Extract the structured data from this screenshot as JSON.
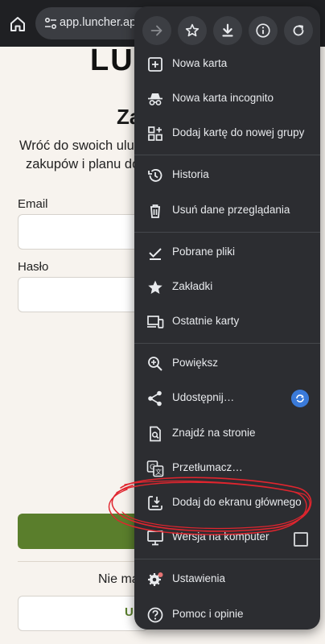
{
  "browser": {
    "url": "app.luncher.app/au"
  },
  "page": {
    "logo": "LUI",
    "heading": "Za",
    "subtitle_line1": "Wróć do swoich ulub",
    "subtitle_line2": "zakupów i planu dop",
    "email_label": "Email",
    "password_label": "Hasło",
    "no_account_text": "Nie ma",
    "alt_button_text": "U"
  },
  "menu": {
    "toolbar": [
      {
        "name": "forward-icon"
      },
      {
        "name": "bookmark-star-icon"
      },
      {
        "name": "download-icon"
      },
      {
        "name": "info-icon"
      },
      {
        "name": "reload-icon"
      }
    ],
    "items": [
      {
        "label": "Nowa karta",
        "icon": "new-tab-icon"
      },
      {
        "label": "Nowa karta incognito",
        "icon": "incognito-icon"
      },
      {
        "label": "Dodaj kartę do nowej grupy",
        "icon": "tab-group-icon"
      },
      {
        "label": "Historia",
        "icon": "history-icon"
      },
      {
        "label": "Usuń dane przeglądania",
        "icon": "trash-icon"
      },
      {
        "label": "Pobrane pliki",
        "icon": "downloads-icon"
      },
      {
        "label": "Zakładki",
        "icon": "bookmarks-star-icon"
      },
      {
        "label": "Ostatnie karty",
        "icon": "devices-icon"
      },
      {
        "label": "Powiększ",
        "icon": "zoom-icon"
      },
      {
        "label": "Udostępnij…",
        "icon": "share-icon"
      },
      {
        "label": "Znajdź na stronie",
        "icon": "find-in-page-icon"
      },
      {
        "label": "Przetłumacz…",
        "icon": "translate-icon"
      },
      {
        "label": "Dodaj do ekranu głównego",
        "icon": "add-to-home-icon"
      },
      {
        "label": "Wersja na komputer",
        "icon": "desktop-icon"
      },
      {
        "label": "Ustawienia",
        "icon": "settings-icon"
      },
      {
        "label": "Pomoc i opinie",
        "icon": "help-icon"
      }
    ],
    "desktop_site_checked": false
  },
  "colors": {
    "menu_bg": "#2c2d31",
    "accent_green": "#5a7e2c",
    "annotation_red": "#e0252e",
    "share_badge": "#3a7ad9"
  }
}
